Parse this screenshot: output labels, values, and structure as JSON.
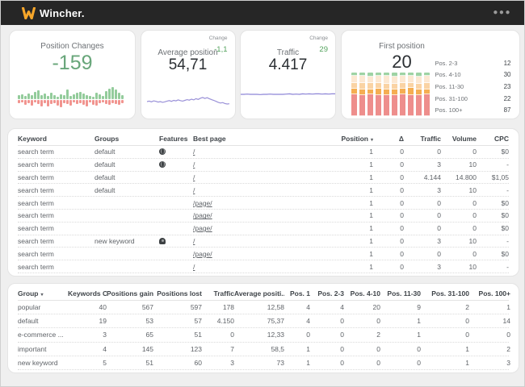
{
  "topbar": {
    "brand": "Wincher.",
    "accent": "#f7a62a",
    "bg": "#262626",
    "menu_icon": "more-options"
  },
  "cards": {
    "position_changes": {
      "title": "Position Changes",
      "value": "-159"
    },
    "average_position": {
      "title": "Average position",
      "value": "54,71",
      "change_label": "Change",
      "change_value": "-1,1"
    },
    "traffic": {
      "title": "Traffic",
      "value": "4.417",
      "change_label": "Change",
      "change_value": "29"
    },
    "first_position": {
      "title": "First position",
      "value": "20",
      "legend": [
        {
          "label": "Pos. 2-3",
          "value": "12"
        },
        {
          "label": "Pos. 4-10",
          "value": "30"
        },
        {
          "label": "Pos. 11-30",
          "value": "23"
        },
        {
          "label": "Pos. 31-100",
          "value": "22"
        },
        {
          "label": "Pos. 100+",
          "value": "87"
        }
      ]
    }
  },
  "chart_data": {
    "position_changes": {
      "type": "bar",
      "up": [
        5,
        6,
        4,
        7,
        5,
        9,
        11,
        5,
        7,
        4,
        8,
        5,
        3,
        6,
        5,
        12,
        4,
        6,
        8,
        9,
        7,
        5,
        4,
        3,
        8,
        6,
        4,
        10,
        13,
        15,
        12,
        8,
        5
      ],
      "down": [
        4,
        3,
        6,
        4,
        7,
        3,
        5,
        8,
        4,
        8,
        5,
        4,
        7,
        9,
        4,
        5,
        7,
        3,
        5,
        4,
        6,
        8,
        3,
        6,
        7,
        4,
        3,
        5,
        6,
        4,
        5,
        6,
        4
      ],
      "colors": {
        "up": "#93cc9b",
        "down": "#f1948f"
      }
    },
    "average_position": {
      "type": "line",
      "values": [
        40,
        42,
        39,
        43,
        41,
        38,
        40,
        37,
        39,
        42,
        44,
        41,
        45,
        43,
        47,
        44,
        42,
        45,
        48,
        46,
        50,
        47,
        52,
        49,
        54,
        57,
        53,
        56,
        52,
        48,
        45,
        41,
        37,
        34,
        36,
        32,
        30,
        31
      ],
      "color": "#9a91d8"
    },
    "traffic": {
      "type": "line",
      "values": [
        50,
        50,
        51,
        50,
        50,
        50,
        49,
        50,
        50,
        51,
        50,
        50,
        50,
        50,
        51,
        52,
        50,
        51,
        50,
        52,
        51,
        52,
        51,
        52,
        52,
        51,
        52,
        51,
        52,
        52
      ],
      "color": "#8c84d6"
    },
    "first_position": {
      "type": "stacked-bar",
      "bars": [
        [
          8,
          16,
          14,
          12,
          50
        ],
        [
          8,
          17,
          13,
          13,
          49
        ],
        [
          9,
          16,
          13,
          12,
          50
        ],
        [
          8,
          16,
          14,
          13,
          49
        ],
        [
          8,
          18,
          13,
          12,
          49
        ],
        [
          9,
          17,
          13,
          12,
          49
        ],
        [
          8,
          16,
          13,
          13,
          50
        ],
        [
          8,
          16,
          12,
          16,
          48
        ],
        [
          9,
          17,
          13,
          13,
          48
        ],
        [
          8,
          17,
          13,
          12,
          50
        ]
      ],
      "colors": [
        "#9ed3a4",
        "#fce8d2",
        "#fad3a4",
        "#f5ae52",
        "#ee8e8c"
      ],
      "legend_labels": [
        "Pos. 2-3",
        "Pos. 4-10",
        "Pos. 11-30",
        "Pos. 31-100",
        "Pos. 100+"
      ]
    }
  },
  "keyword_table": {
    "headers": [
      "Keyword",
      "Groups",
      "Features",
      "Best page",
      "Position",
      "Δ",
      "Traffic",
      "Volume",
      "CPC"
    ],
    "sort_indicator": "▾",
    "rows": [
      [
        "search term",
        "default",
        "globe-icon",
        "/",
        "1",
        "0",
        "0",
        "0",
        "$0"
      ],
      [
        "search term",
        "default",
        "globe-icon",
        "/",
        "1",
        "0",
        "3",
        "10",
        "-"
      ],
      [
        "search term",
        "default",
        "",
        "/",
        "1",
        "0",
        "4.144",
        "14.800",
        "$1,05"
      ],
      [
        "search term",
        "default",
        "",
        "/",
        "1",
        "0",
        "3",
        "10",
        "-"
      ],
      [
        "search term",
        "",
        "",
        "/page/",
        "1",
        "0",
        "0",
        "0",
        "$0"
      ],
      [
        "search term",
        "",
        "",
        "/page/",
        "1",
        "0",
        "0",
        "0",
        "$0"
      ],
      [
        "search term",
        "",
        "",
        "/page/",
        "1",
        "0",
        "0",
        "0",
        "$0"
      ],
      [
        "search term",
        "new keyword",
        "pin-icon",
        "/",
        "1",
        "0",
        "3",
        "10",
        "-"
      ],
      [
        "search term",
        "",
        "",
        "/page/",
        "1",
        "0",
        "0",
        "0",
        "$0"
      ],
      [
        "search term",
        "",
        "",
        "/",
        "1",
        "0",
        "3",
        "10",
        "-"
      ]
    ]
  },
  "group_table": {
    "headers": [
      "Group",
      "Keywords Cou...",
      "Positions gain...",
      "Positions lost",
      "Traffic",
      "Average positi...",
      "Pos. 1",
      "Pos. 2-3",
      "Pos. 4-10",
      "Pos. 11-30",
      "Pos. 31-100",
      "Pos. 100+"
    ],
    "sort_indicator": "▾",
    "rows": [
      [
        "popular",
        "40",
        "567",
        "597",
        "178",
        "12,58",
        "4",
        "4",
        "20",
        "9",
        "2",
        "1"
      ],
      [
        "default",
        "19",
        "53",
        "57",
        "4.150",
        "75,37",
        "4",
        "0",
        "0",
        "1",
        "0",
        "14"
      ],
      [
        "e-commerce ...",
        "3",
        "65",
        "51",
        "0",
        "12,33",
        "0",
        "0",
        "2",
        "1",
        "0",
        "0"
      ],
      [
        "important",
        "4",
        "145",
        "123",
        "7",
        "58,5",
        "1",
        "0",
        "0",
        "0",
        "1",
        "2"
      ],
      [
        "new keyword",
        "5",
        "51",
        "60",
        "3",
        "73",
        "1",
        "0",
        "0",
        "0",
        "1",
        "3"
      ]
    ]
  }
}
